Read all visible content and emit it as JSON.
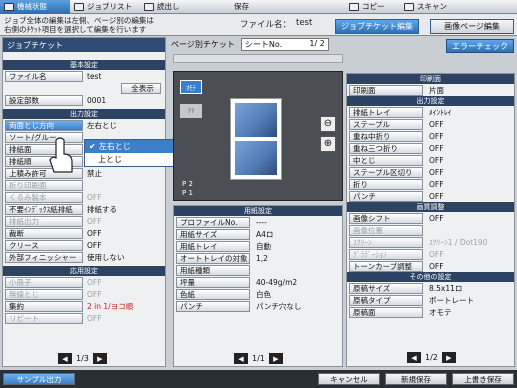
{
  "menubar": [
    {
      "label": "機械状態",
      "active": true
    },
    {
      "label": "ジョブリスト"
    },
    {
      "label": "読出し"
    },
    {
      "label": "保存"
    },
    {
      "label": "コピー"
    },
    {
      "label": "スキャン"
    }
  ],
  "info": {
    "line1": "ジョブ全体の編集は左側、ページ別の編集は",
    "line2": "右側のﾁｹｯﾄ項目を選択して編集を行います",
    "filename_label": "ファイル名：",
    "filename": "test"
  },
  "tabs": {
    "job_ticket_edit": "ジョブチケット編集",
    "image_page_edit": "画像ページ編集"
  },
  "left": {
    "title": "ジョブチケット",
    "basic_header": "基本設定",
    "file_name_label": "ファイル名",
    "file_name": "test",
    "show_all": "全表示",
    "copies_label": "設定部数",
    "copies": "0001",
    "output_header": "出力設定",
    "rows": [
      {
        "label": "両面とじ方向",
        "value": "左右とじ",
        "sel": true
      },
      {
        "label": "ソート/グルー",
        "value": ""
      },
      {
        "label": "排紙面",
        "value": ""
      },
      {
        "label": "排紙順",
        "value": "順方向"
      },
      {
        "label": "上積み許可",
        "value": "禁止"
      },
      {
        "label": "折り印刷面",
        "value": "",
        "dis": true
      },
      {
        "label": "くるみ製本",
        "value": "OFF",
        "dis": true
      },
      {
        "label": "不要ｲﾝﾃﾞｯｸｽ紙排紙",
        "value": "排紙する"
      },
      {
        "label": "排紙出力",
        "value": "OFF",
        "dis": true
      },
      {
        "label": "裁断",
        "value": "OFF"
      },
      {
        "label": "クリース",
        "value": "OFF"
      },
      {
        "label": "外部フィニッシャー",
        "value": "使用しない"
      }
    ],
    "apply_header": "応用設定",
    "apply_rows": [
      {
        "label": "小冊子",
        "value": "OFF",
        "dis": true
      },
      {
        "label": "無線とじ",
        "value": "OFF",
        "dis": true
      },
      {
        "label": "集約",
        "value": "2 in 1/ヨコ順",
        "red": true
      },
      {
        "label": "リピート",
        "value": "OFF",
        "dis": true
      }
    ],
    "page": "1/3"
  },
  "dropdown": {
    "items": [
      "左右とじ",
      "上とじ"
    ],
    "checked": "✔"
  },
  "mid": {
    "title": "ページ別チケット",
    "sheet_label": "シートNo.",
    "sheet_value": "1/  2",
    "error_check": "エラーチェック",
    "order_btn": "ｵﾓﾃ",
    "page_btn": "??",
    "p2": "P 2",
    "p1": "P 1",
    "paper_header": "用紙設定",
    "rows": [
      {
        "label": "プロファイルNo.",
        "value": "----"
      },
      {
        "label": "用紙サイズ",
        "value": "A4ロ"
      },
      {
        "label": "用紙トレイ",
        "value": "自動"
      },
      {
        "label": "オートトレイの対象",
        "value": "1,2"
      },
      {
        "label": "用紙種類",
        "value": ""
      },
      {
        "label": "坪量",
        "value": "40-49g/m2"
      },
      {
        "label": "色紙",
        "value": "白色"
      },
      {
        "label": "パンチ",
        "value": "パンチ穴なし"
      }
    ],
    "page": "1/1"
  },
  "right": {
    "print_header": "印刷面",
    "print_label": "印刷面",
    "print_value": "片面",
    "output_header": "出力設定",
    "rows": [
      {
        "label": "排紙トレイ",
        "value": "ﾒｲﾝﾄﾚｲ"
      },
      {
        "label": "ステープル",
        "value": "OFF"
      },
      {
        "label": "重ね中折り",
        "value": "OFF"
      },
      {
        "label": "重ね三つ折り",
        "value": "OFF"
      },
      {
        "label": "中とじ",
        "value": "OFF"
      },
      {
        "label": "ステープル区切り",
        "value": "OFF"
      },
      {
        "label": "折り",
        "value": "OFF"
      },
      {
        "label": "パンチ",
        "value": "OFF"
      }
    ],
    "img_header": "画質調整",
    "img_rows": [
      {
        "label": "画像シフト",
        "value": "OFF"
      },
      {
        "label": "画像位置",
        "value": "",
        "dis": true
      },
      {
        "label": "ｽｸﾘｰﾝ",
        "value": "ｽｸﾘｰﾝ1 / Dot190",
        "dis": true
      },
      {
        "label": "ｸﾞﾗﾃﾞｰｼｮﾝ",
        "value": "OFF",
        "dis": true
      },
      {
        "label": "トーンカーブ調整",
        "value": "OFF"
      }
    ],
    "other_header": "その他の設定",
    "other_rows": [
      {
        "label": "原稿サイズ",
        "value": "8.5x11ロ"
      },
      {
        "label": "原稿タイプ",
        "value": "ポートレート"
      },
      {
        "label": "原稿面",
        "value": "オモテ"
      }
    ],
    "page": "1/2"
  },
  "bottom": {
    "sample": "サンプル出力",
    "cancel": "キャンセル",
    "new_save": "新規保存",
    "overwrite": "上書き保存"
  }
}
